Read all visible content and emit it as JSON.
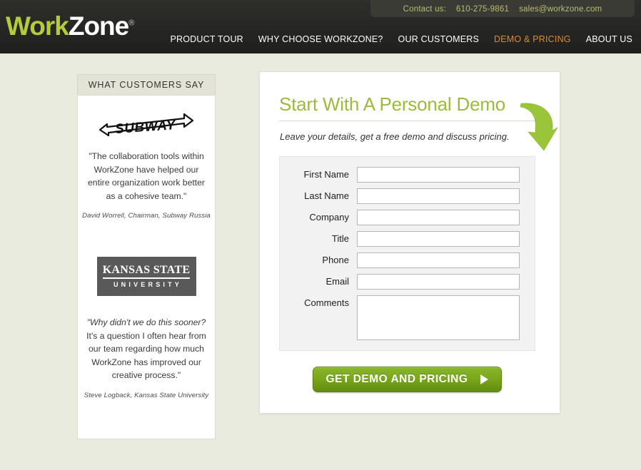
{
  "header": {
    "contact": {
      "label": "Contact us:",
      "phone": "610-275-9861",
      "email": "sales@workzone.com"
    },
    "logo": {
      "part1": "Work",
      "part2": "Zone",
      "trademark": "®"
    },
    "nav": [
      {
        "label": "PRODUCT TOUR",
        "active": false
      },
      {
        "label": "WHY CHOOSE WORKZONE?",
        "active": false
      },
      {
        "label": "OUR CUSTOMERS",
        "active": false
      },
      {
        "label": "DEMO & PRICING",
        "active": true
      },
      {
        "label": "ABOUT US",
        "active": false
      }
    ],
    "accent_active": "#d98b36",
    "logo_green": "#b3cc3b",
    "bar_text_color": "#b9bd73"
  },
  "sidebar": {
    "title": "WHAT CUSTOMERS SAY",
    "testimonials": [
      {
        "logo_name": "subway-logo",
        "logo_text": "SUBWAY",
        "quote": "\"The collaboration tools within WorkZone have helped our entire organization work better\nas a cohesive team.\"",
        "attribution": "David Worrell, Chairman, Subway Russia"
      },
      {
        "logo_name": "kansas-state-university-logo",
        "logo_line1": "KANSAS STATE",
        "logo_line2": "UNIVERSITY",
        "quote_italic": "\"Why didn't we do this sooner?",
        "quote_rest": " It's a question I often hear from our team regarding how much WorkZone has improved our creative process.\"",
        "attribution": "Steve Logback, Kansas State University"
      }
    ]
  },
  "main": {
    "title": "Start With A Personal Demo",
    "subtitle": "Leave your details, get a free demo and discuss pricing.",
    "title_color": "#9cbb3c",
    "arrow_name": "curved-green-arrow-icon",
    "form": {
      "fields": [
        {
          "label": "First Name",
          "name": "first-name",
          "value": "",
          "placeholder": "",
          "type": "text"
        },
        {
          "label": "Last Name",
          "name": "last-name",
          "value": "",
          "placeholder": "",
          "type": "text"
        },
        {
          "label": "Company",
          "name": "company",
          "value": "",
          "placeholder": "",
          "type": "text"
        },
        {
          "label": "Title",
          "name": "title",
          "value": "",
          "placeholder": "",
          "type": "text"
        },
        {
          "label": "Phone",
          "name": "phone",
          "value": "",
          "placeholder": "",
          "type": "text"
        },
        {
          "label": "Email",
          "name": "email",
          "value": "",
          "placeholder": "",
          "type": "text"
        },
        {
          "label": "Comments",
          "name": "comments",
          "value": "",
          "placeholder": "",
          "type": "textarea"
        }
      ],
      "submit_label": "GET DEMO AND PRICING",
      "submit_color": "#7aa81c"
    }
  },
  "page": {
    "background": "#eaebdf"
  }
}
